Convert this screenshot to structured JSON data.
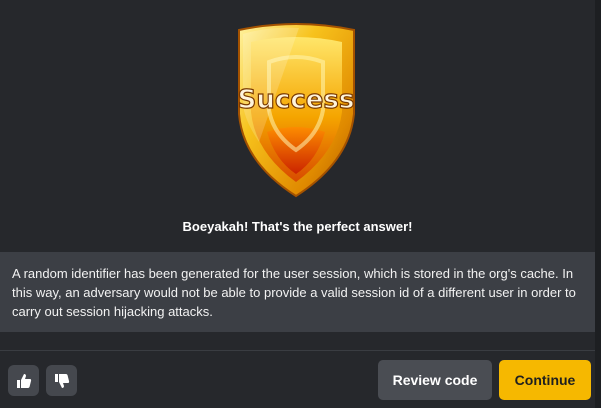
{
  "badge": {
    "text": "Success",
    "icon": "success-shield"
  },
  "result": {
    "headline": "Boeyakah! That's the perfect answer!"
  },
  "explanation": {
    "text": "A random identifier has been generated for the user session, which is stored in the org's cache. In this way, an adversary would not be able to provide a valid session id of a different user in order to carry out session hijacking attacks."
  },
  "footer": {
    "thumbs_up_icon": "thumbs-up-icon",
    "thumbs_down_icon": "thumbs-down-icon",
    "review_label": "Review code",
    "continue_label": "Continue"
  },
  "colors": {
    "accent": "#f6b800",
    "panel": "#26282c",
    "explanation_bg": "#3c3f45"
  }
}
